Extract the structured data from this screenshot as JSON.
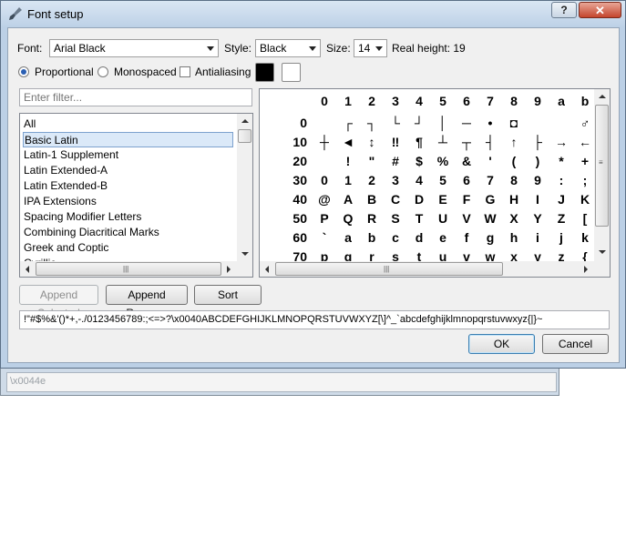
{
  "window": {
    "title": "Font setup",
    "help_label": "?",
    "close_label": "✕"
  },
  "font_row": {
    "font_label": "Font:",
    "font_value": "Arial Black",
    "style_label": "Style:",
    "style_value": "Black",
    "size_label": "Size:",
    "size_value": "14",
    "real_height_label": "Real height: 19"
  },
  "options": {
    "proportional_label": "Proportional",
    "proportional_selected": true,
    "monospaced_label": "Monospaced",
    "monospaced_selected": false,
    "antialiasing_label": "Antialiasing",
    "antialiasing_checked": false,
    "fg_color": "#000000",
    "bg_color": "#ffffff"
  },
  "filter": {
    "placeholder": "Enter filter..."
  },
  "blocks": {
    "items": [
      "All",
      "Basic Latin",
      "Latin-1 Supplement",
      "Latin Extended-A",
      "Latin Extended-B",
      "IPA Extensions",
      "Spacing Modifier Letters",
      "Combining Diacritical Marks",
      "Greek and Coptic",
      "Cyrillic"
    ],
    "selected_index": 1
  },
  "char_grid": {
    "col_headers": [
      "0",
      "1",
      "2",
      "3",
      "4",
      "5",
      "6",
      "7",
      "8",
      "9",
      "a",
      "b"
    ],
    "rows": [
      {
        "label": "0",
        "cells": [
          "",
          "┌",
          "┐",
          "└",
          "┘",
          "│",
          "─",
          "•",
          "◘",
          "",
          "",
          "♂"
        ]
      },
      {
        "label": "10",
        "cells": [
          "┼",
          "◄",
          "↕",
          "‼",
          "¶",
          "┴",
          "┬",
          "┤",
          "↑",
          "├",
          "→",
          "←"
        ]
      },
      {
        "label": "20",
        "cells": [
          "",
          "!",
          "\"",
          "#",
          "$",
          "%",
          "&",
          "'",
          "(",
          ")",
          "*",
          "+"
        ]
      },
      {
        "label": "30",
        "cells": [
          "0",
          "1",
          "2",
          "3",
          "4",
          "5",
          "6",
          "7",
          "8",
          "9",
          ":",
          ";"
        ]
      },
      {
        "label": "40",
        "cells": [
          "@",
          "A",
          "B",
          "C",
          "D",
          "E",
          "F",
          "G",
          "H",
          "I",
          "J",
          "K"
        ]
      },
      {
        "label": "50",
        "cells": [
          "P",
          "Q",
          "R",
          "S",
          "T",
          "U",
          "V",
          "W",
          "X",
          "Y",
          "Z",
          "["
        ]
      },
      {
        "label": "60",
        "cells": [
          "`",
          "a",
          "b",
          "c",
          "d",
          "e",
          "f",
          "g",
          "h",
          "i",
          "j",
          "k"
        ]
      },
      {
        "label": "70",
        "cells": [
          "p",
          "q",
          "r",
          "s",
          "t",
          "u",
          "v",
          "w",
          "x",
          "y",
          "z",
          "{"
        ]
      }
    ]
  },
  "buttons": {
    "append_selected": "Append Selected",
    "append_range": "Append Range...",
    "sort": "Sort",
    "ok": "OK",
    "cancel": "Cancel"
  },
  "chars_field": {
    "value": "!\"#$%&'()*+,-./0123456789:;<=>?\\x0040ABCDEFGHIJKLMNOPQRSTUVWXYZ[\\]^_`abcdefghijklmnopqrstuvwxyz{|}~"
  },
  "background_window": {
    "field_text": "\\x0044e"
  }
}
